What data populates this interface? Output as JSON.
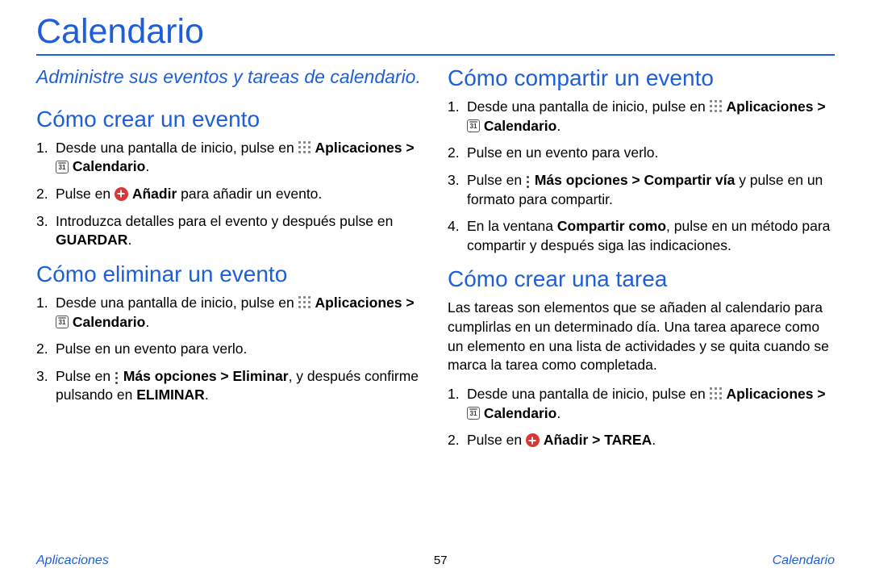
{
  "title": "Calendario",
  "subtitle": "Administre sus eventos y tareas de calendario.",
  "s1": {
    "heading": "Cómo crear un evento",
    "li1a": "Desde una pantalla de inicio, pulse en ",
    "li1b": "Aplicaciones",
    "li1c": " > ",
    "li1d": "Calendario",
    "li1e": ".",
    "li2a": "Pulse en ",
    "li2b": "Añadir",
    "li2c": " para añadir un evento.",
    "li3a": "Introduzca detalles para el evento y después pulse en ",
    "li3b": "GUARDAR",
    "li3c": "."
  },
  "s2": {
    "heading": "Cómo eliminar un evento",
    "li1a": "Desde una pantalla de inicio, pulse en ",
    "li1b": "Aplicaciones",
    "li1c": " > ",
    "li1d": "Calendario",
    "li1e": ".",
    "li2": "Pulse en un evento para verlo.",
    "li3a": "Pulse en ",
    "li3b": "Más opciones > Eliminar",
    "li3c": ", y después confirme pulsando en ",
    "li3d": "ELIMINAR",
    "li3e": "."
  },
  "s3": {
    "heading": "Cómo compartir un evento",
    "li1a": "Desde una pantalla de inicio, pulse en ",
    "li1b": "Aplicaciones",
    "li1c": " > ",
    "li1d": "Calendario",
    "li1e": ".",
    "li2": "Pulse en un evento para verlo.",
    "li3a": "Pulse en ",
    "li3b": "Más opciones > Compartir vía",
    "li3c": " y pulse en un formato para compartir.",
    "li4a": "En la ventana ",
    "li4b": "Compartir como",
    "li4c": ", pulse en un método para compartir y después siga las indicaciones."
  },
  "s4": {
    "heading": "Cómo crear una tarea",
    "intro": "Las tareas son elementos que se añaden al calendario para cumplirlas en un determinado día. Una tarea aparece como un elemento en una lista de actividades y se quita cuando se marca la tarea como completada.",
    "li1a": "Desde una pantalla de inicio, pulse en ",
    "li1b": "Aplicaciones",
    "li1c": " > ",
    "li1d": "Calendario",
    "li1e": ".",
    "li2a": "Pulse en ",
    "li2b": "Añadir",
    "li2c": " > ",
    "li2d": "TAREA",
    "li2e": "."
  },
  "footer": {
    "left": "Aplicaciones",
    "center": "57",
    "right": "Calendario"
  },
  "cal_day": "31"
}
